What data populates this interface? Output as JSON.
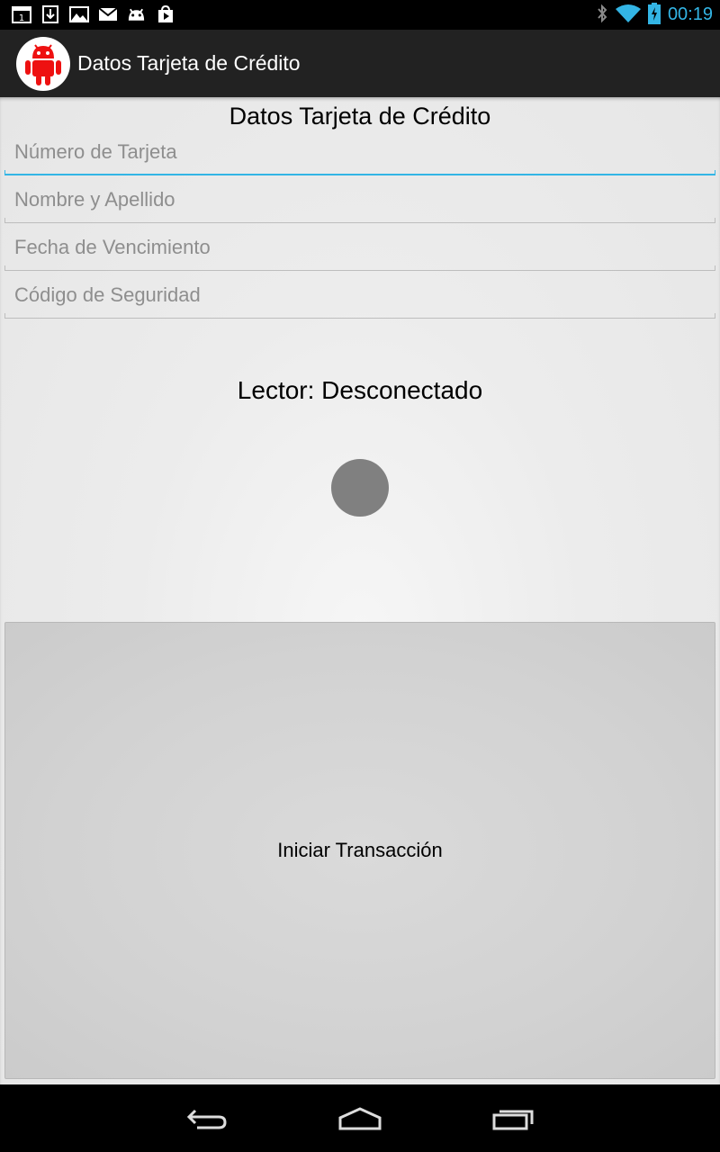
{
  "status_bar": {
    "time": "00:19",
    "left_icons": [
      "calendar-icon",
      "download-icon",
      "gallery-icon",
      "gmail-icon",
      "android-debug-icon",
      "play-store-icon"
    ],
    "right_icons": [
      "bluetooth-icon",
      "wifi-icon",
      "battery-charging-icon"
    ],
    "accent_color": "#33b5e5"
  },
  "action_bar": {
    "title": "Datos Tarjeta de Crédito",
    "app_icon": "android-robot-icon",
    "app_icon_color": "#ee1111"
  },
  "form": {
    "title": "Datos Tarjeta de Crédito",
    "fields": [
      {
        "placeholder": "Número de Tarjeta",
        "value": "",
        "focused": true
      },
      {
        "placeholder": "Nombre y Apellido",
        "value": "",
        "focused": false
      },
      {
        "placeholder": "Fecha de Vencimiento",
        "value": "",
        "focused": false
      },
      {
        "placeholder": "Código de Seguridad",
        "value": "",
        "focused": false
      }
    ]
  },
  "reader": {
    "status_text": "Lector: Desconectado",
    "indicator_color": "#808080"
  },
  "start_button": {
    "label": "Iniciar Transacción"
  },
  "nav_bar": {
    "buttons": [
      "back-icon",
      "home-icon",
      "recent-apps-icon"
    ]
  }
}
